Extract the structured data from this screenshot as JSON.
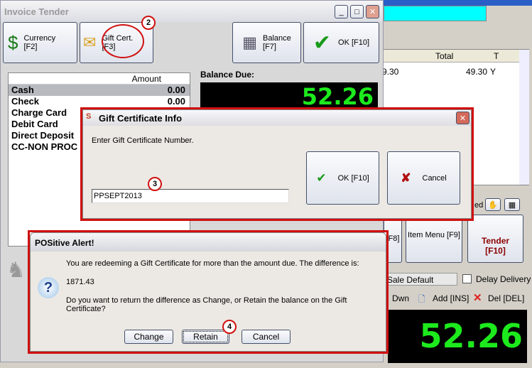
{
  "main_window": {
    "title": "Invoice Tender",
    "buttons": [
      {
        "label": "Currency",
        "key": "[F2]",
        "icon": "money-bag-icon"
      },
      {
        "label": "Gift Cert.",
        "key": "[F3]",
        "icon": "gift-envelope-icon"
      },
      {
        "label": "Balance",
        "key": "[F7]",
        "icon": "cash-register-icon"
      },
      {
        "label": "OK [F10]",
        "icon": "checkmark-icon"
      }
    ],
    "tender_header": "Amount",
    "tenders": [
      {
        "name": "Cash",
        "amount": "0.00"
      },
      {
        "name": "Check",
        "amount": "0.00"
      },
      {
        "name": "Charge Card",
        "amount": ""
      },
      {
        "name": "Debit Card",
        "amount": ""
      },
      {
        "name": "Direct Deposit",
        "amount": ""
      },
      {
        "name": "CC-NON PROC",
        "amount": ""
      }
    ],
    "balance_due_label": "Balance Due:",
    "balance_due": "52.26"
  },
  "background": {
    "grid_headers": [
      "Total",
      "T"
    ],
    "row": {
      "prev": "9.30",
      "total": "49.30",
      "t": "Y"
    },
    "fragment_label": "ed",
    "buttons": {
      "f8": "[F8]",
      "item_menu": "Item Menu [F9]",
      "tender": "Tender",
      "tender_key": "[F10]"
    },
    "sale_default": "Sale Default",
    "delay_delivery": "Delay Delivery",
    "dwn": "Dwn",
    "add": "Add [INS]",
    "del": "Del [DEL]",
    "total": "52.26"
  },
  "gift_dialog": {
    "title": "Gift Certificate Info",
    "prompt": "Enter Gift Certificate Number.",
    "value": "PPSEPT2013",
    "ok": "OK [F10]",
    "cancel": "Cancel"
  },
  "alert": {
    "title": "POSitive Alert!",
    "line1": "You are redeeming a Gift Certificate for more than the amount due.  The difference is:",
    "amount": "1871.43",
    "line2": "Do you want to return the difference as Change, or Retain the balance on the Gift Certificate?",
    "buttons": [
      "Change",
      "Retain",
      "Cancel"
    ]
  },
  "callouts": [
    "2",
    "3",
    "4"
  ],
  "colors": {
    "accent_red": "#d01010",
    "lcd_green": "#1dea1d",
    "cyan_field": "#00ffff",
    "tender_red": "#8b0000"
  }
}
